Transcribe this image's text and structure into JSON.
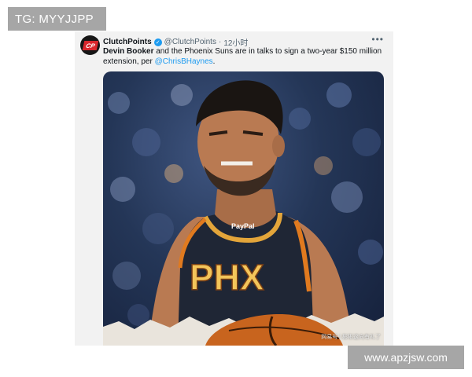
{
  "overlay": {
    "tg_text": "TG: MYYJJPP",
    "site_text": "www.apzjsw.com"
  },
  "tweet": {
    "avatar_text": "CP",
    "display_name": "ClutchPoints",
    "handle": "@ClutchPoints",
    "separator": "·",
    "timestamp": "12小时",
    "more_icon": "more-horizontal-icon",
    "text_bold": "Devin Booker",
    "text_body": " and the Phoenix Suns are in talks to sign a two-year $150 million extension, per ",
    "mention": "@ChrisBHaynes",
    "text_end": "."
  },
  "media": {
    "jersey_text": "PHX",
    "sponsor_text": "PayPal",
    "watermark": "网易号 | 彬彬这向有礼了"
  },
  "colors": {
    "verified": "#1d9bf0",
    "mention": "#1d9bf0",
    "jersey": "#1f2635",
    "jersey_trim": "#e07a1f",
    "overlay_bg": "#a6a6a6"
  }
}
